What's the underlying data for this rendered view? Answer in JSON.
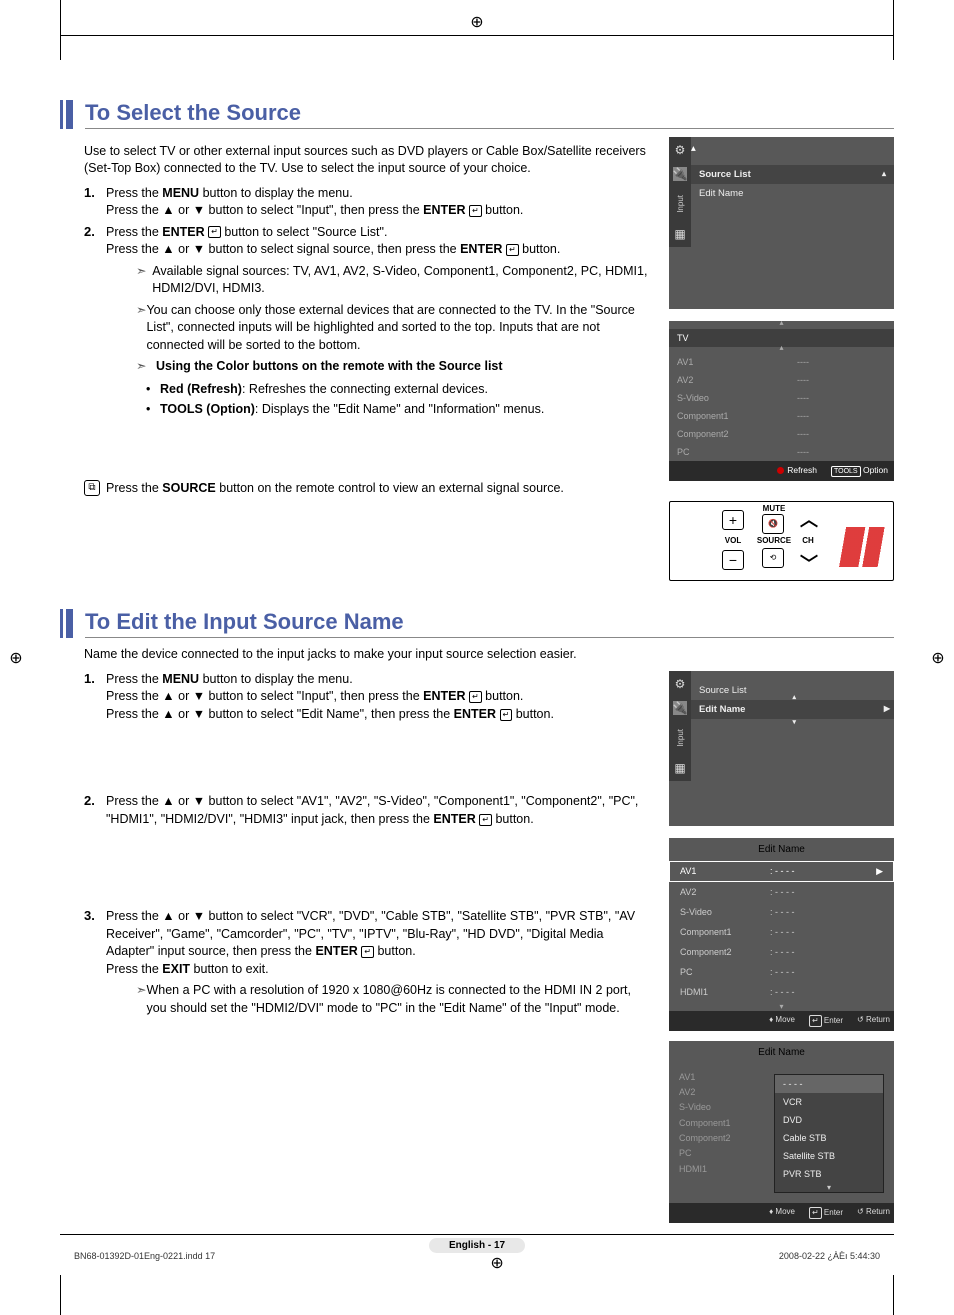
{
  "page_footer": {
    "file": "BN68-01392D-01Eng-0221.indd   17",
    "timestamp": "2008-02-22   ¿ÀÈı 5:44:30",
    "page_label": "English - 17"
  },
  "section1": {
    "title": "To Select the Source",
    "intro": "Use to select TV or other external input sources such as DVD players or Cable Box/Satellite receivers (Set-Top Box) connected to the TV. Use to select the input source of your choice.",
    "step1a": "Press the ",
    "step1a_b": "MENU",
    "step1a2": " button to display the menu.",
    "step1b": "Press the ▲ or ▼ button to select \"Input\", then press the ",
    "step1b_b": "ENTER",
    "step1b2": " button.",
    "step2a": "Press the ",
    "step2a_b": "ENTER",
    "step2a2": " button to select \"Source List\".",
    "step2b": "Press the ▲ or ▼ button to select signal source, then press the ",
    "step2b_b": "ENTER",
    "step2b2": " button.",
    "sub1": "Available signal sources: TV, AV1, AV2, S-Video, Component1, Component2, PC, HDMI1, HDMI2/DVI, HDMI3.",
    "sub2": "You can choose only those external devices that are connected to the TV. In the \"Source List\", connected inputs will be highlighted and sorted to the top. Inputs that are not connected will be sorted to the bottom.",
    "sub3_b": "Using the Color buttons on the remote with the Source list",
    "bullet1_b": "Red (Refresh)",
    "bullet1": ": Refreshes the connecting external devices.",
    "bullet2_b": "TOOLS (Option)",
    "bullet2": ": Displays the \"Edit Name\" and \"Information\" menus.",
    "note1": "Press the ",
    "note1_b": "SOURCE",
    "note1_2": " button on the remote control to view an external signal source."
  },
  "section2": {
    "title": "To Edit the Input Source Name",
    "intro": "Name the device connected to the input jacks to make your input source selection easier.",
    "s1a": "Press the ",
    "s1a_b": "MENU",
    "s1a2": " button to display the menu.",
    "s1b": "Press the ▲ or ▼ button to select \"Input\", then press the ",
    "s1b_b": "ENTER",
    "s1b2": " button.",
    "s1c": "Press the ▲ or ▼ button to select \"Edit Name\", then press the ",
    "s1c_b": "ENTER",
    "s1c2": " button.",
    "s2a": "Press the ▲ or ▼ button to select \"AV1\", \"AV2\", \"S-Video\", \"Component1\", \"Component2\", \"PC\", \"HDMI1\", \"HDMI2/DVI\", \"HDMI3\" input jack, then press the ",
    "s2a_b": "ENTER",
    "s2a2": " button.",
    "s3a": "Press the ▲ or ▼ button to select \"VCR\", \"DVD\", \"Cable STB\", \"Satellite STB\", \"PVR STB\", \"AV Receiver\", \"Game\", \"Camcorder\", \"PC\", \"TV\", \"IPTV\", \"Blu-Ray\", \"HD DVD\", \"Digital Media Adapter\" input source, then press the ",
    "s3a_b": "ENTER",
    "s3a2": " button.",
    "s3b": "Press the ",
    "s3b_b": "EXIT",
    "s3b2": " button to exit.",
    "s3_sub": "When a PC with a resolution of 1920 x 1080@60Hz is connected to the HDMI IN 2 port, you should set the \"HDMI2/DVI\" mode to \"PC\" in the \"Edit Name\" of the \"Input\" mode."
  },
  "osd1": {
    "side_label": "Input",
    "source_list": "Source List",
    "edit_name": "Edit Name"
  },
  "osd_source_list": {
    "title_sel": "TV",
    "rows": [
      {
        "name": "AV1",
        "val": "----"
      },
      {
        "name": "AV2",
        "val": "----"
      },
      {
        "name": "S-Video",
        "val": "----"
      },
      {
        "name": "Component1",
        "val": "----"
      },
      {
        "name": "Component2",
        "val": "----"
      },
      {
        "name": "PC",
        "val": "----"
      }
    ],
    "footer_refresh": "Refresh",
    "footer_option": "Option",
    "tools_label": "TOOLS"
  },
  "remote": {
    "mute": "MUTE",
    "vol": "VOL",
    "source": "SOURCE",
    "ch": "CH",
    "plus": "+",
    "minus": "−"
  },
  "osd_edit1": {
    "source_list": "Source List",
    "edit_name": "Edit Name",
    "side_label": "Input"
  },
  "osd_edit_table": {
    "title": "Edit Name",
    "rows": [
      {
        "n": "AV1",
        "v": "- - - -"
      },
      {
        "n": "AV2",
        "v": "- - - -"
      },
      {
        "n": "S-Video",
        "v": "- - - -"
      },
      {
        "n": "Component1",
        "v": "- - - -"
      },
      {
        "n": "Component2",
        "v": "- - - -"
      },
      {
        "n": "PC",
        "v": "- - - -"
      },
      {
        "n": "HDMI1",
        "v": "- - - -"
      }
    ],
    "footer_move": "Move",
    "footer_enter": "Enter",
    "footer_return": "Return"
  },
  "osd_popup": {
    "title": "Edit Name",
    "left": [
      "AV1",
      "AV2",
      "S-Video",
      "Component1",
      "Component2",
      "PC",
      "HDMI1"
    ],
    "opts": [
      "- - - -",
      "VCR",
      "DVD",
      "Cable STB",
      "Satellite STB",
      "PVR STB"
    ],
    "footer_move": "Move",
    "footer_enter": "Enter",
    "footer_return": "Return"
  }
}
